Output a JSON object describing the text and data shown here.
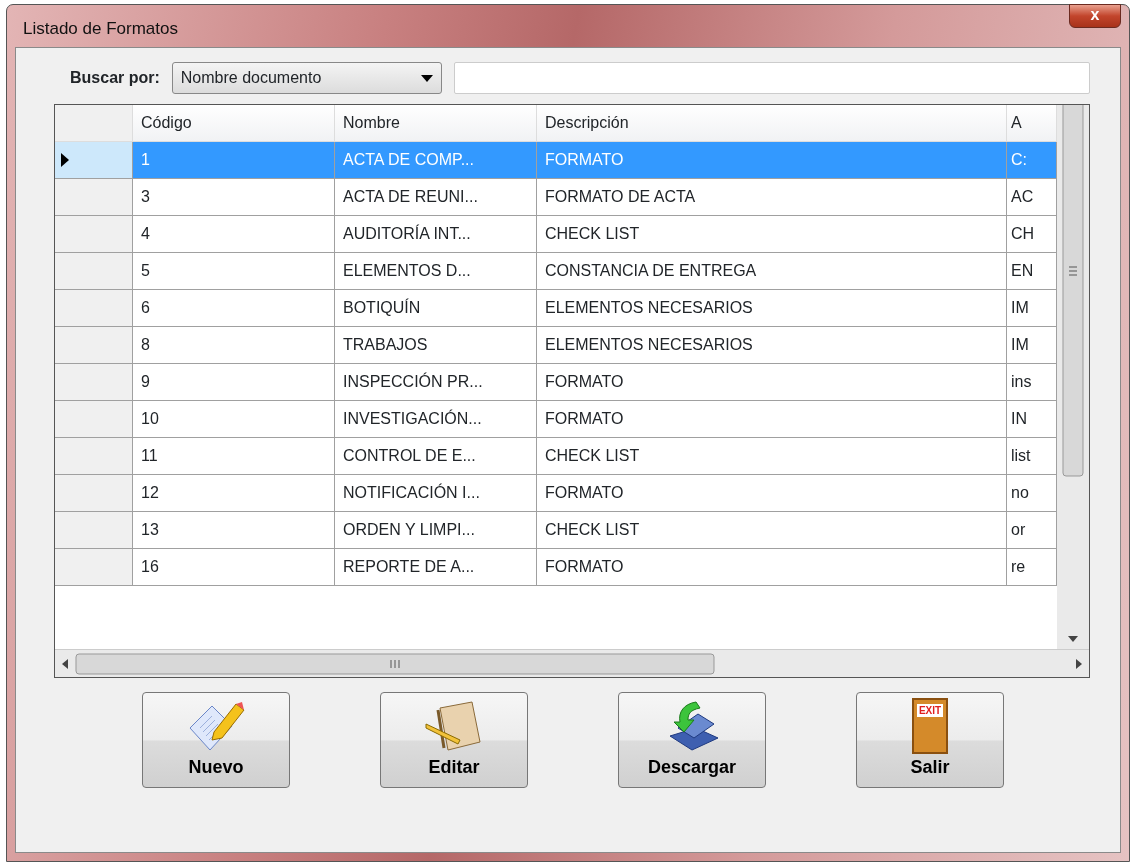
{
  "window": {
    "title": "Listado de Formatos",
    "close_label": "x"
  },
  "search": {
    "label": "Buscar por:",
    "field": "Nombre documento"
  },
  "table": {
    "columns": [
      "Código",
      "Nombre",
      "Descripción",
      "A"
    ],
    "rows": [
      {
        "cells": [
          "1",
          "ACTA DE COMP...",
          "FORMATO",
          "C:"
        ],
        "selected": true
      },
      {
        "cells": [
          "3",
          "ACTA DE REUNI...",
          "FORMATO DE ACTA",
          "AC"
        ],
        "selected": false
      },
      {
        "cells": [
          "4",
          "AUDITORÍA INT...",
          "CHECK LIST",
          "CH"
        ],
        "selected": false
      },
      {
        "cells": [
          "5",
          "ELEMENTOS D...",
          "CONSTANCIA DE ENTREGA",
          "EN"
        ],
        "selected": false
      },
      {
        "cells": [
          "6",
          "BOTIQUÍN",
          "ELEMENTOS NECESARIOS",
          "IM"
        ],
        "selected": false
      },
      {
        "cells": [
          "8",
          "TRABAJOS",
          "ELEMENTOS NECESARIOS",
          "IM"
        ],
        "selected": false
      },
      {
        "cells": [
          "9",
          "INSPECCIÓN PR...",
          "FORMATO",
          "ins"
        ],
        "selected": false
      },
      {
        "cells": [
          "10",
          "INVESTIGACIÓN...",
          "FORMATO",
          "IN"
        ],
        "selected": false
      },
      {
        "cells": [
          "11",
          "CONTROL DE E...",
          "CHECK LIST",
          "list"
        ],
        "selected": false
      },
      {
        "cells": [
          "12",
          "NOTIFICACIÓN I...",
          "FORMATO",
          "no"
        ],
        "selected": false
      },
      {
        "cells": [
          "13",
          "ORDEN Y LIMPI...",
          "CHECK LIST",
          "or"
        ],
        "selected": false
      },
      {
        "cells": [
          "16",
          "REPORTE DE A...",
          "FORMATO",
          "re"
        ],
        "selected": false
      }
    ]
  },
  "buttons": [
    {
      "label": "Nuevo",
      "kind": "new"
    },
    {
      "label": "Editar",
      "kind": "edit"
    },
    {
      "label": "Descargar",
      "kind": "download"
    },
    {
      "label": "Salir",
      "kind": "exit",
      "icon_text": "EXIT"
    }
  ]
}
